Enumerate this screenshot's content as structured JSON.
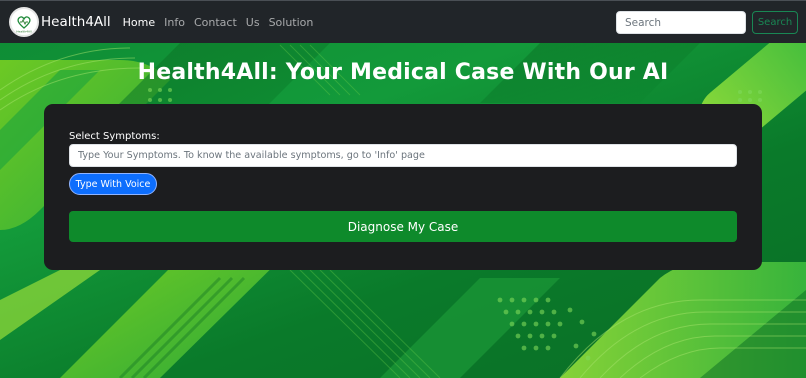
{
  "navbar": {
    "logo_text": "Health4All",
    "brand": "Health4All",
    "links": [
      {
        "label": "Home",
        "active": true
      },
      {
        "label": "Info",
        "active": false
      },
      {
        "label": "Contact",
        "active": false
      },
      {
        "label": "Us",
        "active": false
      },
      {
        "label": "Solution",
        "active": false
      }
    ],
    "search_placeholder": "Search",
    "search_button": "Search"
  },
  "hero": {
    "title": "Health4All: Your Medical Case With Our AI"
  },
  "form": {
    "symptoms_label": "Select Symptoms:",
    "symptoms_placeholder": "Type Your Symptoms. To know the available symptoms, go to 'Info' page",
    "voice_button": "Type With Voice",
    "diagnose_button": "Diagnose My Case"
  },
  "colors": {
    "navbar_bg": "#212529",
    "card_bg": "#1c1d1f",
    "primary_blue": "#0d6efd",
    "diagnose_green": "#0e8a2b",
    "search_outline": "#198754"
  }
}
